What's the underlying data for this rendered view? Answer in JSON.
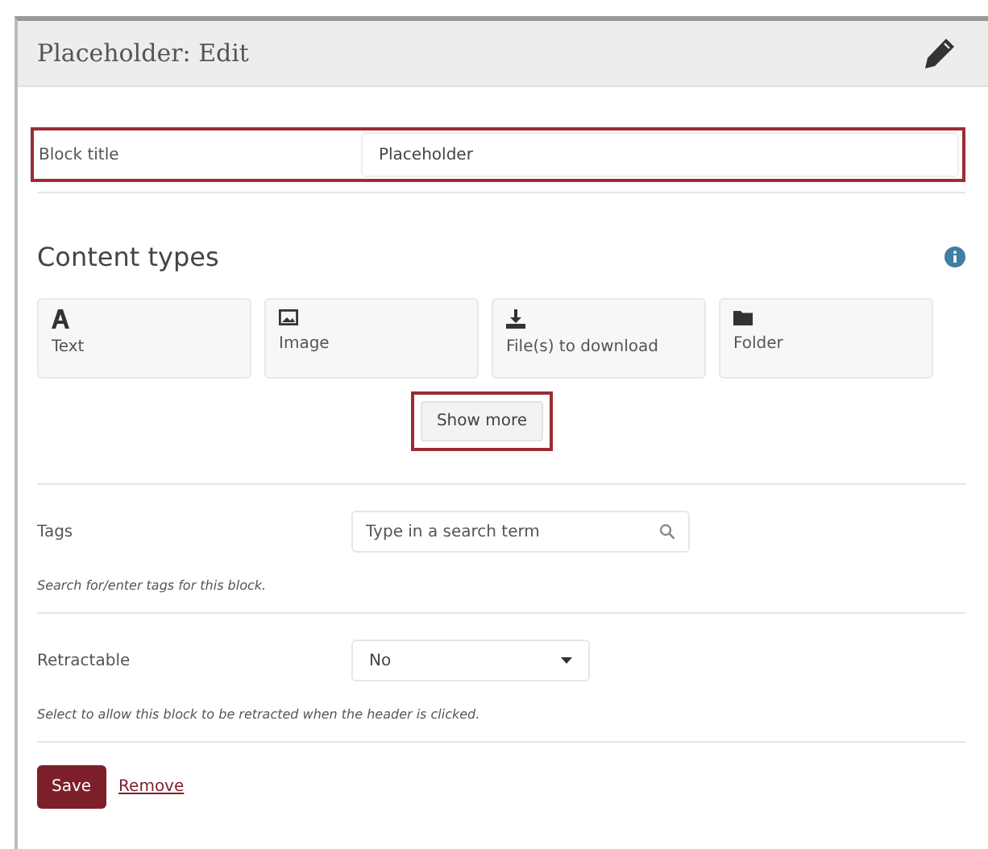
{
  "header": {
    "title": "Placeholder: Edit"
  },
  "block_title": {
    "label": "Block title",
    "value": "Placeholder",
    "highlighted": true
  },
  "content_types": {
    "heading": "Content types",
    "items": [
      {
        "kind": "text",
        "label": "Text"
      },
      {
        "kind": "image",
        "label": "Image"
      },
      {
        "kind": "download",
        "label": "File(s) to download"
      },
      {
        "kind": "folder",
        "label": "Folder"
      }
    ],
    "show_more": {
      "label": "Show more",
      "highlighted": true
    }
  },
  "tags": {
    "label": "Tags",
    "placeholder": "Type in a search term",
    "hint": "Search for/enter tags for this block."
  },
  "retractable": {
    "label": "Retractable",
    "value": "No",
    "hint": "Select to allow this block to be retracted when the header is clicked."
  },
  "actions": {
    "save": "Save",
    "remove": "Remove"
  }
}
